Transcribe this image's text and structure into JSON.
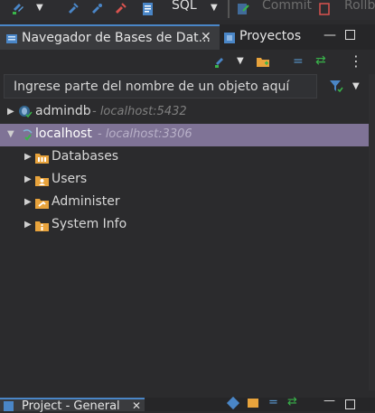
{
  "toolbar": {
    "sql_label": "SQL",
    "commit_label": "Commit",
    "rollback_label": "Rollb"
  },
  "tabs": {
    "navigator_label": "Navegador de Bases de Dat...",
    "projects_label": "Proyectos"
  },
  "search": {
    "placeholder": "Ingrese parte del nombre de un objeto aquí"
  },
  "tree": {
    "connections": [
      {
        "name": "admindb",
        "host": "- localhost:5432",
        "expanded": false,
        "selected": false
      },
      {
        "name": "localhost",
        "host": "- localhost:3306",
        "expanded": true,
        "selected": true
      }
    ],
    "children": [
      {
        "label": "Databases",
        "icon": "databases-folder-icon"
      },
      {
        "label": "Users",
        "icon": "users-folder-icon"
      },
      {
        "label": "Administer",
        "icon": "administer-folder-icon"
      },
      {
        "label": "System Info",
        "icon": "system-info-folder-icon"
      }
    ]
  },
  "bottom_panel": {
    "tab_label": "Project - General"
  },
  "colors": {
    "accent": "#4a86c7",
    "selection": "#7f7396",
    "background": "#2b2b2d",
    "folder": "#e8a33c",
    "connect_green": "#39b54a",
    "disconnect_red": "#d9534f"
  }
}
